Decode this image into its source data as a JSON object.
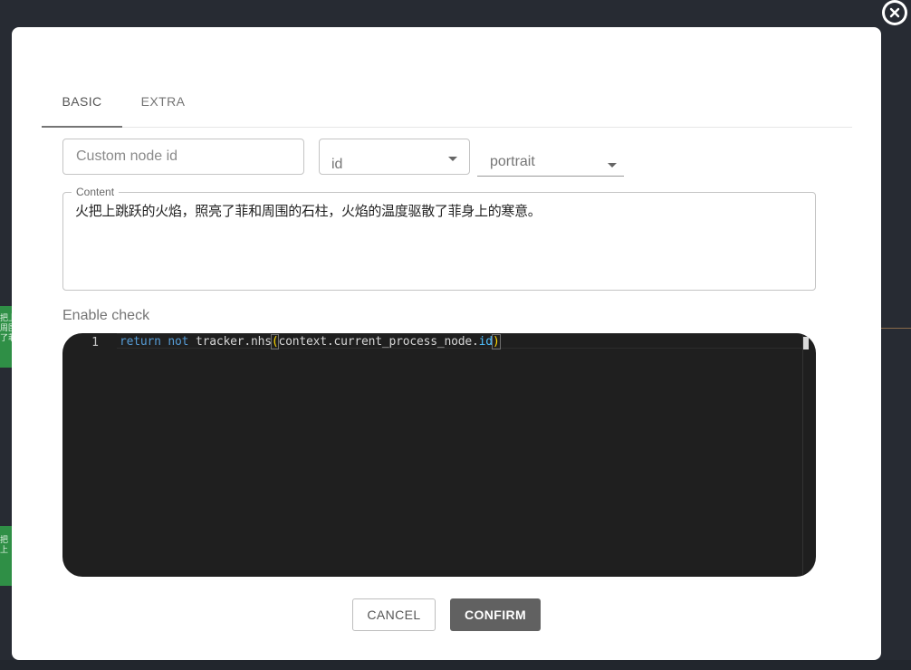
{
  "background": {
    "snippet_1": "把上\n周围\n了菲",
    "snippet_2": "把上"
  },
  "tabs": [
    {
      "label": "BASIC",
      "active": true
    },
    {
      "label": "EXTRA",
      "active": false
    }
  ],
  "fields": {
    "node_id_placeholder": "Custom node id",
    "node_id_value": "",
    "id_select_value": "id",
    "portrait_select_value": "portrait"
  },
  "content": {
    "legend": "Content",
    "text": "火把上跳跃的火焰，照亮了菲和周围的石柱，火焰的温度驱散了菲身上的寒意。"
  },
  "enable_check": {
    "label": "Enable check",
    "line_number": "1",
    "code": {
      "kw_return": "return",
      "kw_not": "not",
      "obj": "tracker.nhs",
      "open_paren": "(",
      "arg": "context.current_process_node.",
      "arg_prop": "id",
      "close_paren": ")"
    }
  },
  "buttons": {
    "cancel": "CANCEL",
    "confirm": "CONFIRM"
  },
  "colors": {
    "accent_tab": "#757575",
    "confirm_bg": "#616161",
    "editor_bg": "#1f1f1f",
    "keyword": "#569cd6",
    "paren": "#ffd700",
    "property": "#4fc1ff"
  }
}
